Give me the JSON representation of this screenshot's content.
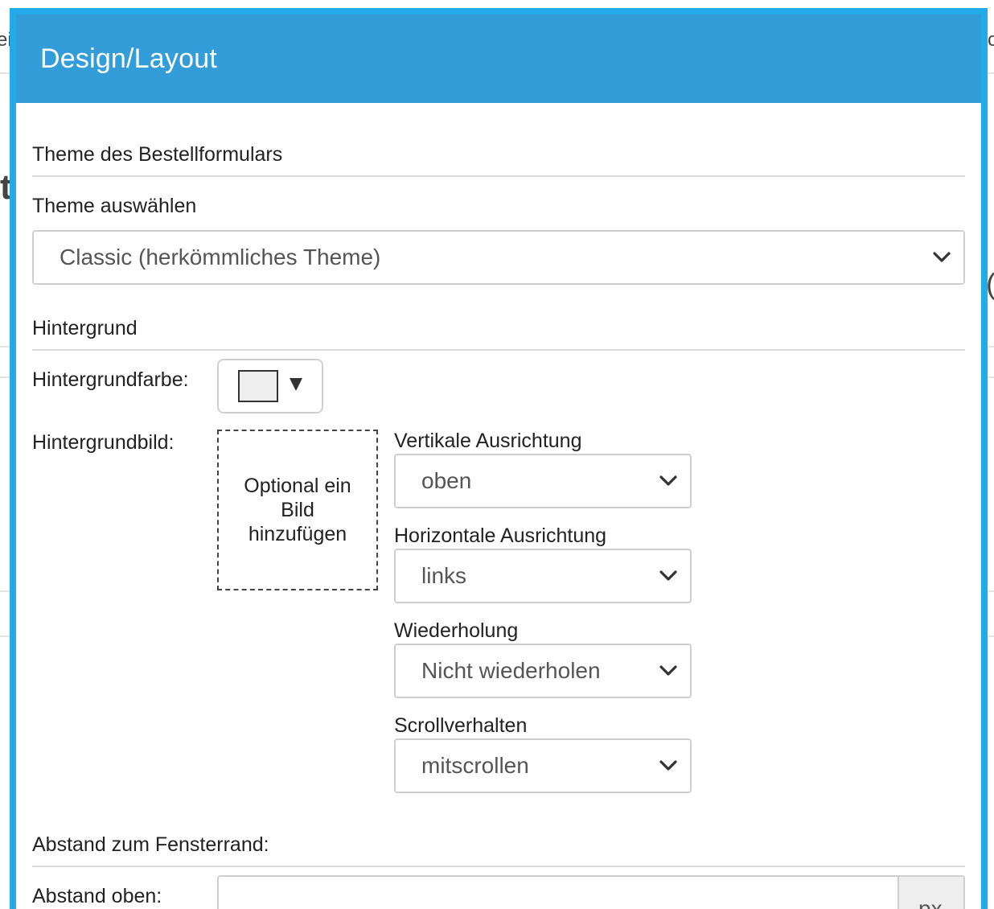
{
  "modal": {
    "title": "Design/Layout"
  },
  "theme_section": {
    "title": "Theme des Bestellformulars",
    "select_label": "Theme auswählen",
    "selected": "Classic (herkömmliches Theme)"
  },
  "background_section": {
    "title": "Hintergrund",
    "color_label": "Hintergrundfarbe:",
    "swatch_color": "#efefef",
    "image_label": "Hintergrundbild:",
    "image_placeholder": "Optional ein Bild hinzufügen",
    "vertical_label": "Vertikale Ausrichtung",
    "vertical_value": "oben",
    "horizontal_label": "Horizontale Ausrichtung",
    "horizontal_value": "links",
    "repeat_label": "Wiederholung",
    "repeat_value": "Nicht wiederholen",
    "scroll_label": "Scrollverhalten",
    "scroll_value": "mitscrollen"
  },
  "spacing_section": {
    "title": "Abstand zum Fensterrand:",
    "top_label": "Abstand oben:",
    "top_unit": "px"
  },
  "background_page": {
    "left_fragment": "ei",
    "right_fragment": "c",
    "big_left_char": "t",
    "big_right_char": "("
  },
  "colors": {
    "header": "#339dd9",
    "modal_border": "#22abe6"
  }
}
